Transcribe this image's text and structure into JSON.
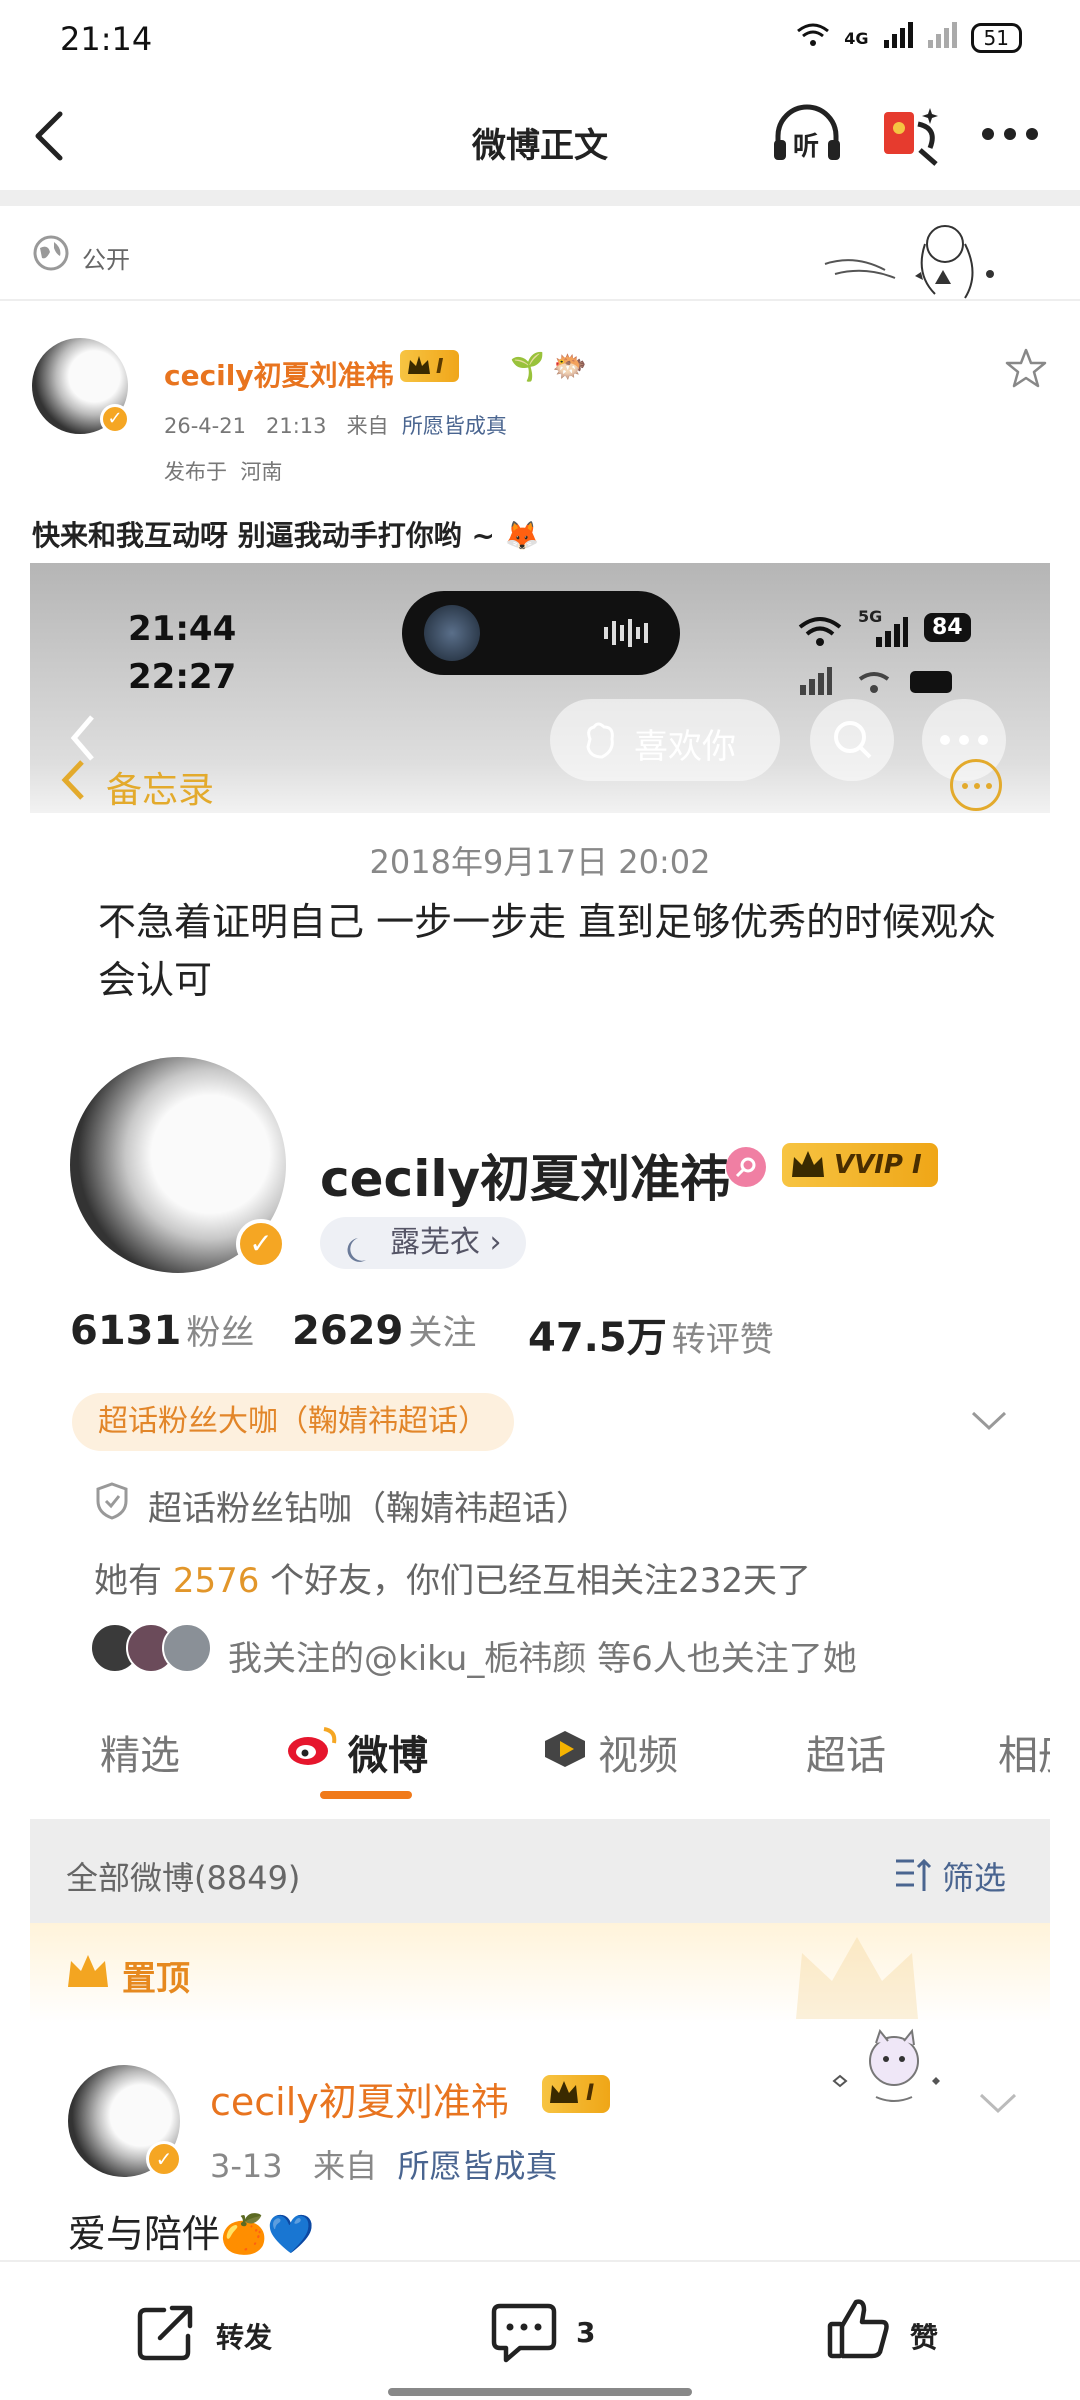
{
  "status_bar": {
    "time": "21:14",
    "network1": "4G",
    "battery": "51"
  },
  "nav": {
    "title": "微博正文",
    "listen_label": "听"
  },
  "visibility": {
    "label": "公开"
  },
  "post": {
    "author": "cecily初夏刘准祎",
    "level_badge": "I",
    "date": "26-4-21",
    "time": "21:13",
    "from_label": "来自",
    "source": "所愿皆成真",
    "location_label": "发布于",
    "location": "河南",
    "text": "快来和我互动呀  别逼我动手打你哟 ~ 🦊"
  },
  "screenshot": {
    "time1": "21:44",
    "time2": "22:27",
    "signal": "5G",
    "battery": "84",
    "like_button": "喜欢你",
    "back_app": "备忘录",
    "memo_date": "2018年9月17日 20:02",
    "memo_text": "不急着证明自己 一步一步走 直到足够优秀的时候观众会认可",
    "profile_name": "cecily初夏刘准祎",
    "vip_badge": "VVIP I",
    "sub_tag": "露芜衣 ›",
    "followers_num": "6131",
    "followers_label": "粉丝",
    "following_num": "2629",
    "following_label": "关注",
    "interactions_num": "47.5万",
    "interactions_label": "转评赞",
    "super_fan_tag": "超话粉丝大咖（鞠婧祎超话）",
    "super_fan_line": "超话粉丝钻咖（鞠婧祎超话）",
    "friends_prefix": "她有 ",
    "friends_count": "2576",
    "friends_suffix": " 个好友，你们已经互相关注232天了",
    "mutual_text": "我关注的@kiku_栀祎颜 等6人也关注了她",
    "tabs": [
      "精选",
      "微博",
      "视频",
      "超话",
      "相册"
    ],
    "all_posts": "全部微博(8849)",
    "filter": "筛选",
    "pinned": "置顶",
    "inner_author": "cecily初夏刘准祎",
    "inner_badge": "I",
    "inner_date": "3-13",
    "inner_from": "来自",
    "inner_source": "所愿皆成真",
    "inner_text": "爱与陪伴🍊💙"
  },
  "actions": {
    "repost": "转发",
    "comment_count": "3",
    "like": "赞"
  },
  "colors": {
    "orange": "#e8741f",
    "blue": "#4a6590",
    "gold": "#f5b301"
  }
}
